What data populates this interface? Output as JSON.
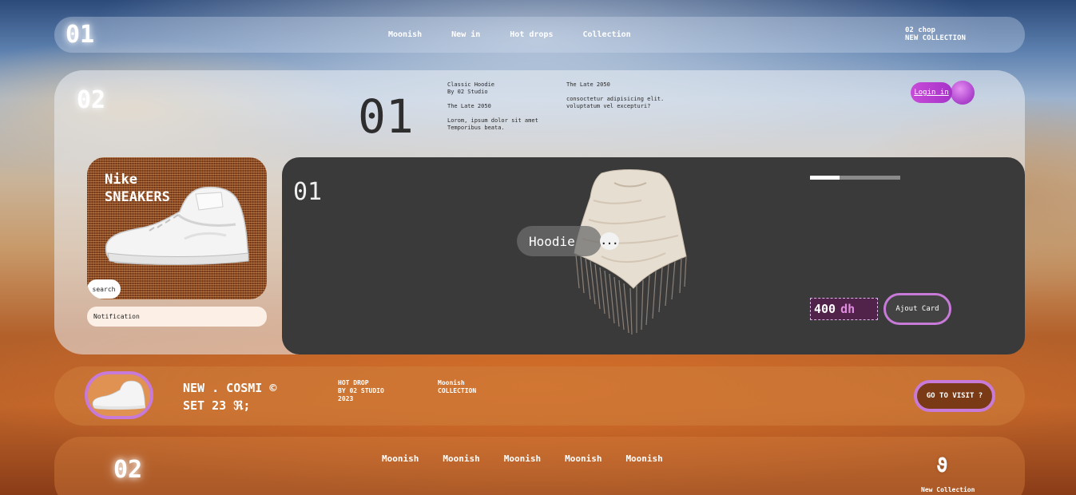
{
  "header": {
    "number": "01",
    "nav": [
      "Moonish",
      "New in",
      "Hot drops",
      "Collection"
    ],
    "side_line1": "02 chop",
    "side_line2": "NEW COLLECTION"
  },
  "hero": {
    "number": "02",
    "big_number": "01",
    "desc_a": {
      "line1": "Classic Hoodie",
      "line2": "By 02 Studio",
      "line3": "The Late 2050",
      "line4": "Lorom, ipsum dolor sit amet",
      "line5": "Temporibus beata."
    },
    "desc_b": {
      "line1": "The Late 2050",
      "line2": "consoctetur adipisicing elit.",
      "line3": "voluptatum vel excepturi?"
    },
    "login_label": "Login in"
  },
  "nike_card": {
    "line1": "Nike",
    "line2": "SNEAKERS",
    "search_label": "search",
    "notification_placeholder": "Notification"
  },
  "product": {
    "number": "01",
    "name": "Hoodie",
    "more_label": "...",
    "progress": 0.33,
    "price_value": "400",
    "price_unit": "dh",
    "cart_label": "Ajout Card"
  },
  "promo": {
    "title_line1": "NEW . COSMI ©",
    "title_line2": "SET 23 ℜ;",
    "col_a": {
      "line1": "HOT DROP",
      "line2": "BY 02 STUDIO",
      "line3": "2023"
    },
    "col_b": {
      "line1": "Moonish",
      "line2": "COLLECTION"
    },
    "visit_label": "GO TO VISIT ?"
  },
  "footer": {
    "number": "02",
    "nav": [
      "Moonish",
      "Moonish",
      "Moonish",
      "Moonish",
      "Moonish"
    ],
    "symbol": "ϑ",
    "caption": "New Collection"
  },
  "colors": {
    "accent": "#c77ad8",
    "card_dark": "#3a3a3a",
    "price_bg": "#52234a"
  },
  "icons": [
    "sneaker-icon",
    "poncho-image",
    "login-orb-icon",
    "more-dots-icon"
  ]
}
